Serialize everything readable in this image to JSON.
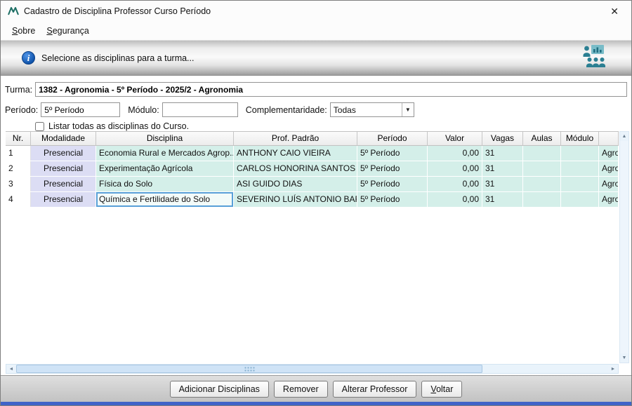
{
  "window": {
    "title": "Cadastro de Disciplina Professor Curso Período"
  },
  "icons": {
    "close": "✕",
    "combo_arrow": "▼",
    "arrow_left": "◄",
    "arrow_right": "►",
    "arrow_up": "▲",
    "arrow_down": "▼"
  },
  "menu": {
    "sobre_head": "S",
    "sobre_tail": "obre",
    "seguranca_head": "S",
    "seguranca_tail": "egurança"
  },
  "banner": {
    "message": "Selecione as disciplinas para a turma..."
  },
  "form": {
    "turma_label": "Turma:",
    "turma_value": "1382 - Agronomia - 5º Período - 2025/2 - Agronomia",
    "periodo_label": "Período:",
    "periodo_value": "5º Período",
    "modulo_label": "Módulo:",
    "modulo_value": "",
    "complementaridade_label": "Complementaridade:",
    "complementaridade_value": "Todas",
    "listar_label": "Listar todas as disciplinas do Curso."
  },
  "table": {
    "columns": [
      "Nr.",
      "Modalidade",
      "Disciplina",
      "Prof. Padrão",
      "Período",
      "Valor",
      "Vagas",
      "Aulas",
      "Módulo"
    ],
    "rows": [
      {
        "nr": "1",
        "modalidade": "Presencial",
        "disciplina": "Economia Rural e Mercados Agrop...",
        "prof": "ANTHONY CAIO VIEIRA",
        "periodo": "5º Período",
        "valor": "0,00",
        "vagas": "31",
        "aulas": "",
        "modulo": "",
        "curso": "Agronomia"
      },
      {
        "nr": "2",
        "modalidade": "Presencial",
        "disciplina": "Experimentação Agrícola",
        "prof": "CARLOS HONORINA SANTOS",
        "periodo": "5º Período",
        "valor": "0,00",
        "vagas": "31",
        "aulas": "",
        "modulo": "",
        "curso": "Agronomia"
      },
      {
        "nr": "3",
        "modalidade": "Presencial",
        "disciplina": "Física do Solo",
        "prof": "ASI GUIDO DIAS",
        "periodo": "5º Período",
        "valor": "0,00",
        "vagas": "31",
        "aulas": "",
        "modulo": "",
        "curso": "Agronomia"
      },
      {
        "nr": "4",
        "modalidade": "Presencial",
        "disciplina": "Química e Fertilidade do Solo",
        "prof": "SEVERINO LUÍS ANTONIO BARB...",
        "periodo": "5º Período",
        "valor": "0,00",
        "vagas": "31",
        "aulas": "",
        "modulo": "",
        "curso": "Agronomia"
      }
    ]
  },
  "actions": {
    "adicionar": "Adicionar Disciplinas",
    "remover": "Remover",
    "alterar": "Alterar Professor",
    "voltar_head": "V",
    "voltar_tail": "oltar"
  },
  "colors": {
    "row_teal": "#d4efe9",
    "modalidade_lavender": "#dcddf4",
    "selection_border": "#59a0d8",
    "info_blue": "#0d51a8",
    "icon_teal": "#2b7f92",
    "bottom_strip_blue": "#3f63c8"
  }
}
